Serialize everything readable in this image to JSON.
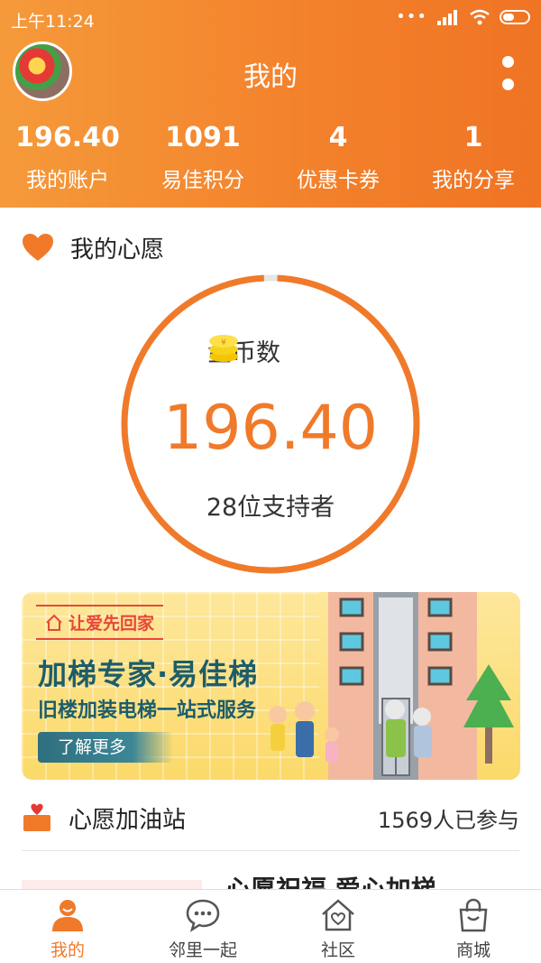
{
  "status_bar": {
    "time": "上午11:24"
  },
  "header": {
    "title": "我的",
    "stats": [
      {
        "value": "196.40",
        "label": "我的账户"
      },
      {
        "value": "1091",
        "label": "易佳积分"
      },
      {
        "value": "4",
        "label": "优惠卡券"
      },
      {
        "value": "1",
        "label": "我的分享"
      }
    ]
  },
  "wish": {
    "title": "我的心愿",
    "coin_label": "金币数",
    "coin_value": "196.40",
    "supporters": "28位支持者",
    "progress_fraction": 0.985
  },
  "banner": {
    "tag": "让爱先回家",
    "title": "加梯专家·易佳梯",
    "subtitle": "旧楼加装电梯一站式服务",
    "button": "了解更多"
  },
  "station": {
    "title": "心愿加油站",
    "count": "1569人已参与",
    "preview_title": "心愿祝福 爱心加梯"
  },
  "tabs": [
    {
      "label": "我的",
      "icon": "person-icon",
      "active": true
    },
    {
      "label": "邻里一起",
      "icon": "chat-icon",
      "active": false
    },
    {
      "label": "社区",
      "icon": "house-heart-icon",
      "active": false
    },
    {
      "label": "商城",
      "icon": "shopping-bag-icon",
      "active": false
    }
  ],
  "colors": {
    "accent": "#f07a2a",
    "header_start": "#f59a3a",
    "header_end": "#ef7424",
    "banner_text": "#1d5d6b"
  }
}
